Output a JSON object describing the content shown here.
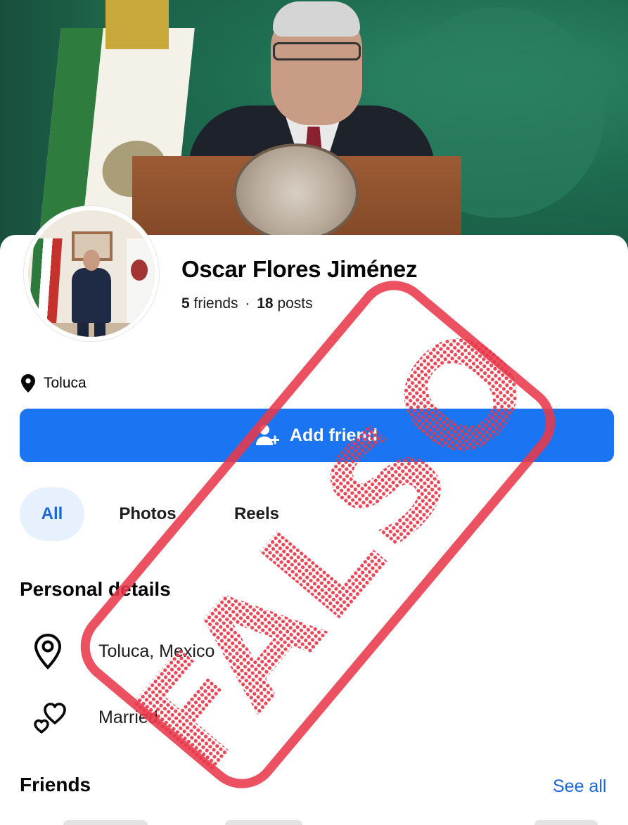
{
  "profile": {
    "name": "Oscar Flores Jiménez",
    "friends_count": "5",
    "friends_label": "friends",
    "separator": "·",
    "posts_count": "18",
    "posts_label": "posts",
    "location": "Toluca"
  },
  "actions": {
    "add_friend_label": "Add friend"
  },
  "tabs": [
    {
      "label": "All",
      "selected": true
    },
    {
      "label": "Photos",
      "selected": false
    },
    {
      "label": "Reels",
      "selected": false
    }
  ],
  "personal_details": {
    "title": "Personal details",
    "items": [
      {
        "icon": "location-pin-icon",
        "text": "Toluca, Mexico"
      },
      {
        "icon": "hearts-icon",
        "text": "Married"
      }
    ]
  },
  "friends": {
    "title": "Friends",
    "see_all_label": "See all"
  },
  "stamp": {
    "text": "FALSO",
    "color": "#e8394a"
  },
  "colors": {
    "primary_blue": "#1b74f2",
    "link_blue": "#1b66d8",
    "tab_selected_bg": "#e7f0fd"
  }
}
